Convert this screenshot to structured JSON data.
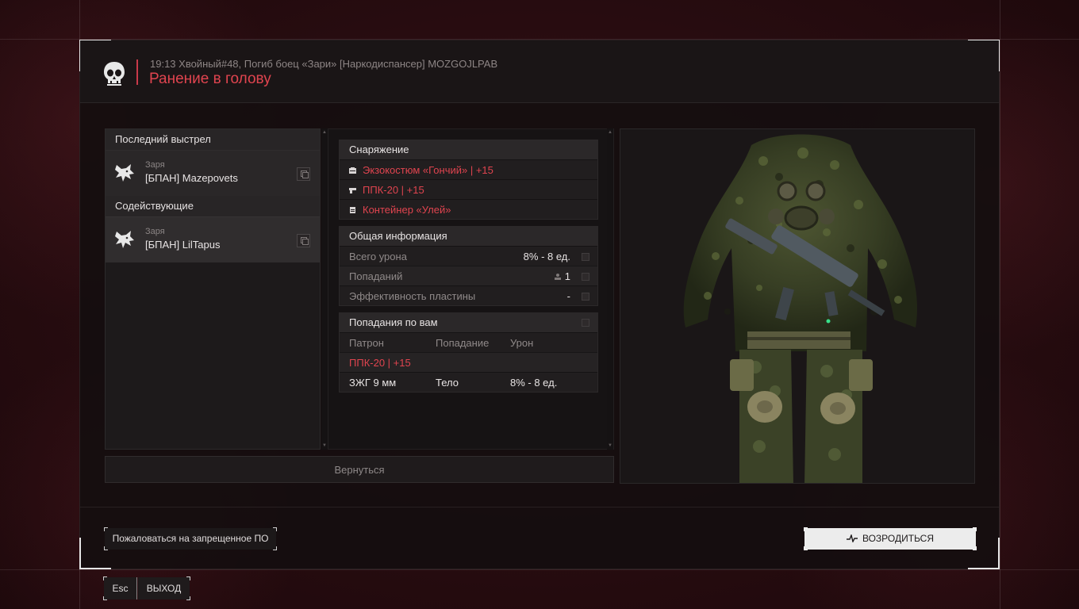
{
  "header": {
    "kill_line": "19:13 Хвойный#48, Погиб боец «Зари» [Наркодиспансер] MOZGOJLPAB",
    "death_cause": "Ранение в голову"
  },
  "left_panel": {
    "last_shot_label": "Последний выстрел",
    "killer": {
      "faction": "Заря",
      "name": "[БПАН] Mazepovets"
    },
    "assists_label": "Содействующие",
    "assists": [
      {
        "faction": "Заря",
        "name": "[БПАН] LilTapus"
      }
    ]
  },
  "equipment": {
    "title": "Снаряжение",
    "items": [
      {
        "label": "Экзокостюм «Гончий» | +15",
        "icon": "armor-icon"
      },
      {
        "label": "ППК-20 | +15",
        "icon": "pistol-icon"
      },
      {
        "label": "Контейнер «Улей»",
        "icon": "container-icon"
      }
    ]
  },
  "general_info": {
    "title": "Общая информация",
    "rows": [
      {
        "label": "Всего урона",
        "value": "8% - 8 ед."
      },
      {
        "label": "Попаданий",
        "value": "1"
      },
      {
        "label": "Эффективность пластины",
        "value": "-"
      }
    ]
  },
  "hits": {
    "title": "Попадания по вам",
    "columns": [
      "Патрон",
      "Попадание",
      "Урон"
    ],
    "weapon": "ППК-20 | +15",
    "rows": [
      {
        "ammo": "ЗЖГ 9 мм",
        "hit": "Тело",
        "damage": "8% - 8 ед."
      }
    ]
  },
  "back_label": "Вернуться",
  "footer": {
    "report_label": "Пожаловаться на запрещенное ПО",
    "respawn_label": "ВОЗРОДИТЬСЯ",
    "esc_key": "Esc",
    "exit_label": "ВЫХОД"
  },
  "colors": {
    "accent_red": "#e0444f",
    "background": "#2a0d11"
  }
}
